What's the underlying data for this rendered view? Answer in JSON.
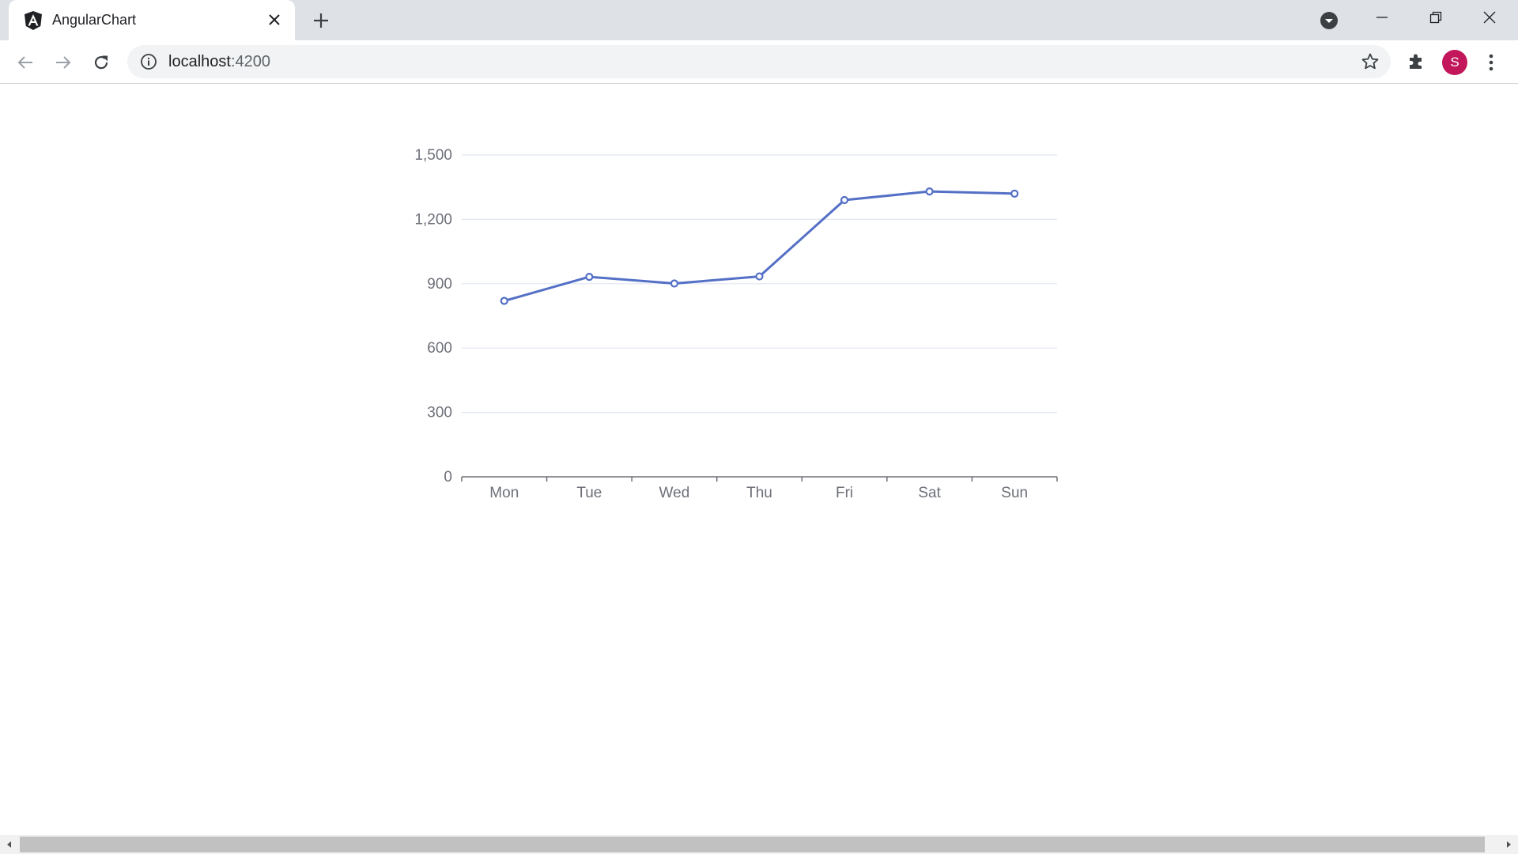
{
  "tab": {
    "title": "AngularChart",
    "favicon": "angular-icon"
  },
  "omnibox": {
    "host": "localhost",
    "port": ":4200"
  },
  "profile": {
    "initial": "S",
    "color": "#c2185b"
  },
  "icons": {
    "back": "arrow-left-icon",
    "forward": "arrow-right-icon",
    "reload": "reload-icon",
    "info": "info-icon",
    "bookmark": "star-icon",
    "extensions": "puzzle-icon",
    "menu": "kebab-menu-icon",
    "new_tab": "plus-icon",
    "tab_close": "close-icon",
    "tab_search": "chevron-down-circle-icon"
  },
  "chart_data": {
    "type": "line",
    "categories": [
      "Mon",
      "Tue",
      "Wed",
      "Thu",
      "Fri",
      "Sat",
      "Sun"
    ],
    "series": [
      {
        "values": [
          820,
          932,
          901,
          934,
          1290,
          1330,
          1320
        ],
        "color": "#5470c6"
      }
    ],
    "ylim": [
      0,
      1500
    ],
    "yticks": [
      0,
      300,
      600,
      900,
      1200,
      1500
    ],
    "ytick_labels": [
      "0",
      "300",
      "600",
      "900",
      "1,200",
      "1,500"
    ],
    "grid": true
  }
}
